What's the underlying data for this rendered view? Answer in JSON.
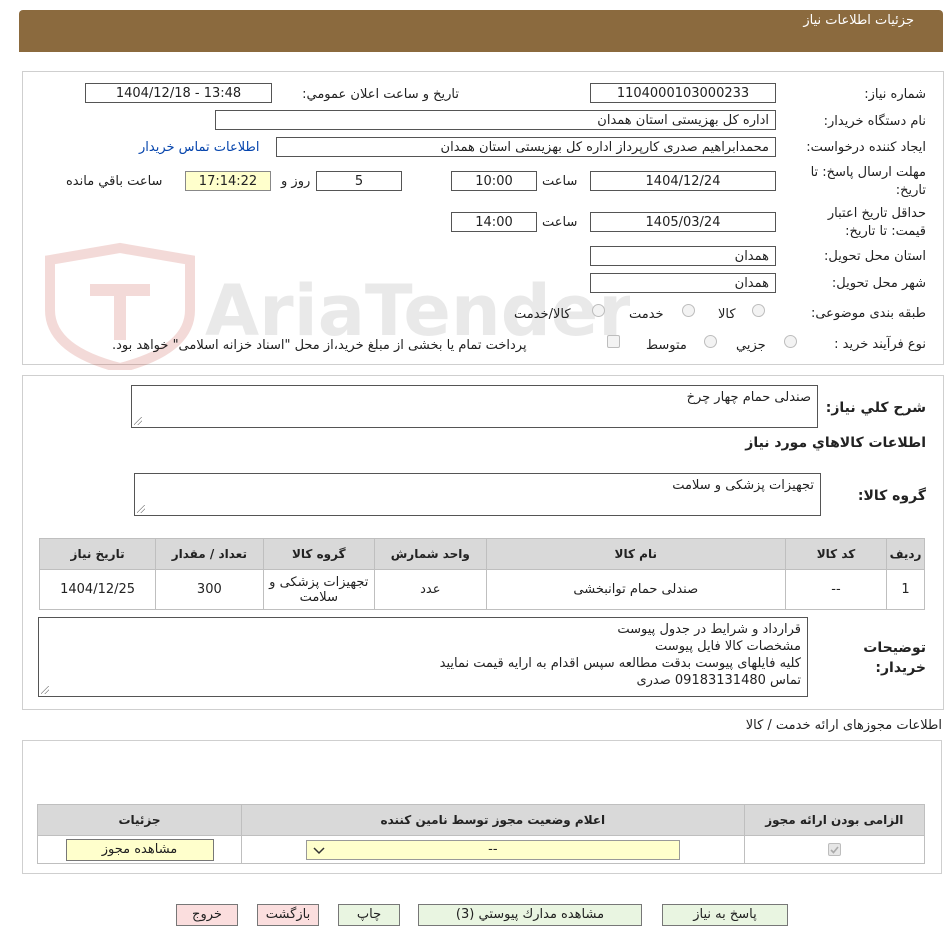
{
  "header": {
    "title": "جزئیات اطلاعات نیاز"
  },
  "form": {
    "need_number_label": "شماره نیاز:",
    "need_number": "1104000103000233",
    "announce_label": "تاریخ و ساعت اعلان عمومي:",
    "announce_value": "1404/12/18 - 13:48",
    "buyer_label": "نام دستگاه خریدار:",
    "buyer": "اداره کل بهزیستی استان همدان",
    "creator_label": "ایجاد کننده درخواست:",
    "creator": "محمدابراهیم صدری کارپرداز اداره کل بهزیستی استان همدان",
    "contact_link": "اطلاعات تماس خریدار",
    "deadline_label": "مهلت ارسال پاسخ: تا تاریخ:",
    "deadline_date": "1404/12/24",
    "time_label": "ساعت",
    "deadline_time": "10:00",
    "days_value": "5",
    "days_label": "روز و",
    "remaining_time": "17:14:22",
    "remaining_label": "ساعت باقي مانده",
    "validity_label": "حداقل تاریخ اعتبار قیمت: تا تاریخ:",
    "validity_date": "1405/03/24",
    "validity_time": "14:00",
    "province_label": "استان محل تحویل:",
    "province": "همدان",
    "city_label": "شهر محل تحویل:",
    "city": "همدان",
    "category_label": "طبقه بندی موضوعی:",
    "category_options": [
      "کالا",
      "خدمت",
      "کالا/خدمت"
    ],
    "process_label": "نوع فرآیند خرید :",
    "process_options": [
      "جزیي",
      "متوسط"
    ],
    "payment_note": "پرداخت تمام یا بخشی از مبلغ خرید،از محل \"اسناد خزانه اسلامی\" خواهد بود."
  },
  "summary": {
    "label": "شرح کلي نیاز:",
    "value": "صندلی حمام چهار چرخ",
    "goods_info_title": "اطلاعات کالاهاي مورد نیاز",
    "group_label": "گروه کالا:",
    "group_value": "تجهیزات پزشکی و سلامت"
  },
  "goods_table": {
    "headers": [
      "ردیف",
      "کد کالا",
      "نام کالا",
      "واحد شمارش",
      "گروه کالا",
      "تعداد / مقدار",
      "تاریخ نیاز"
    ],
    "rows": [
      [
        "1",
        "--",
        "صندلی حمام توانبخشی",
        "عدد",
        "تجهیزات پزشکی و سلامت",
        "300",
        "1404/12/25"
      ]
    ]
  },
  "buyer_notes": {
    "label": "توضیحات خریدار:",
    "lines": [
      "قرارداد و شرایط در جدول پیوست",
      "مشخصات کالا  فایل پیوست",
      "کلیه فایلهای پیوست بدقت مطالعه سپس اقدام به ارایه قیمت نمایید",
      "تماس  09183131480 صدری"
    ]
  },
  "permits": {
    "title": "اطلاعات مجوزهای ارائه خدمت / کالا",
    "headers": [
      "الزامی بودن ارائه مجوز",
      "اعلام وضعیت مجوز توسط نامین کننده",
      "جزئیات"
    ],
    "select_value": "--",
    "view_button": "مشاهده مجوز"
  },
  "actions": {
    "reply": "پاسخ به نیاز",
    "docs": "مشاهده مدارك پیوستي (3)",
    "print": "چاپ",
    "back": "بازگشت",
    "exit": "خروج"
  },
  "watermark": {
    "text": "AriaTender.neT"
  },
  "colors": {
    "header_bg": "#8b6a3e",
    "link": "#0645ad",
    "green_btn": "#e9f5e1",
    "red_btn": "#fbdede",
    "yellow_field": "#ffffcc"
  }
}
